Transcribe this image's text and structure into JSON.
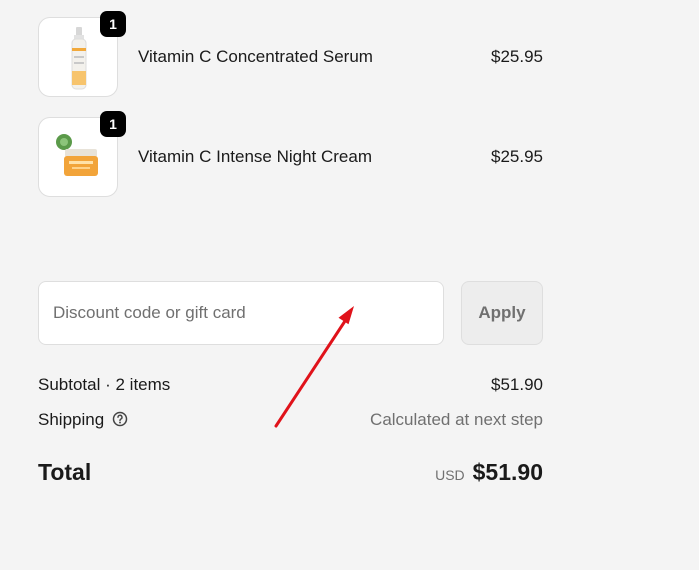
{
  "line_items": [
    {
      "name": "Vitamin C Concentrated Serum",
      "price": "$25.95",
      "quantity": "1",
      "image": "serum-bottle"
    },
    {
      "name": "Vitamin C Intense Night Cream",
      "price": "$25.95",
      "quantity": "1",
      "image": "cream-jar"
    }
  ],
  "discount": {
    "placeholder": "Discount code or gift card",
    "value": "",
    "apply_label": "Apply"
  },
  "summary": {
    "subtotal_label": "Subtotal · 2 items",
    "subtotal_value": "$51.90",
    "shipping_label": "Shipping",
    "shipping_value": "Calculated at next step",
    "total_label": "Total",
    "currency": "USD",
    "total_value": "$51.90"
  },
  "annotation": {
    "color": "#e0121a",
    "type": "red-arrow"
  },
  "colors": {
    "badge": "#000000",
    "muted_text": "#707070",
    "background": "#f4f4f4"
  }
}
